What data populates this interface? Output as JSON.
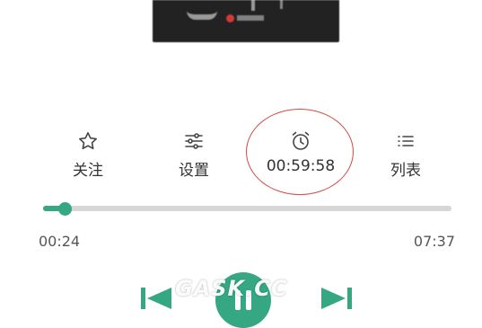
{
  "actions": {
    "follow": {
      "label": "关注",
      "icon": "star-icon"
    },
    "settings": {
      "label": "设置",
      "icon": "sliders-icon"
    },
    "timer": {
      "label": "00:59:58",
      "icon": "alarm-clock-icon"
    },
    "list": {
      "label": "列表",
      "icon": "list-icon"
    }
  },
  "playback": {
    "current_time": "00:24",
    "total_time": "07:37",
    "progress": 0.052
  },
  "watermark": "GASK.CC",
  "colors": {
    "accent": "#35a883",
    "highlight_circle": "#d24b45"
  }
}
